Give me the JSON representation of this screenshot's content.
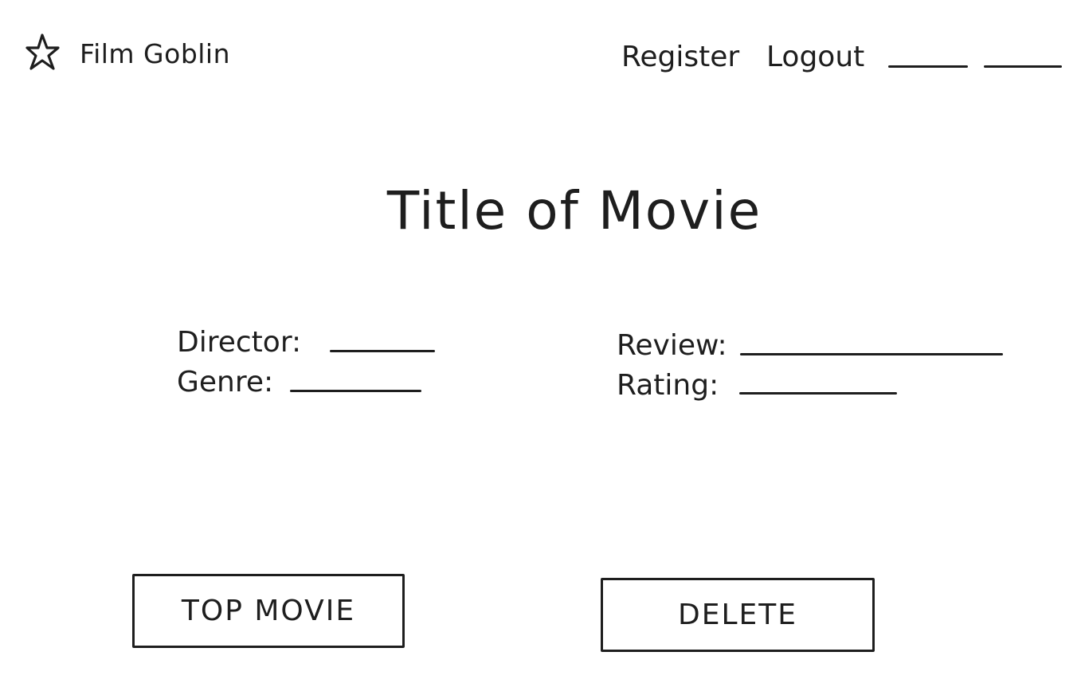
{
  "header": {
    "brand_name": "Film Goblin",
    "logo_icon": "star-icon",
    "nav": {
      "register_label": "Register",
      "logout_label": "Logout"
    }
  },
  "movie": {
    "title": "Title of Movie",
    "details": {
      "director_label": "Director:",
      "genre_label": "Genre:",
      "review_label": "Review:",
      "rating_label": "Rating:"
    }
  },
  "actions": {
    "top_movie_label": "TOP MOVIE",
    "delete_label": "DELETE"
  },
  "colors": {
    "ink": "#1e1e1e",
    "background": "#ffffff"
  }
}
